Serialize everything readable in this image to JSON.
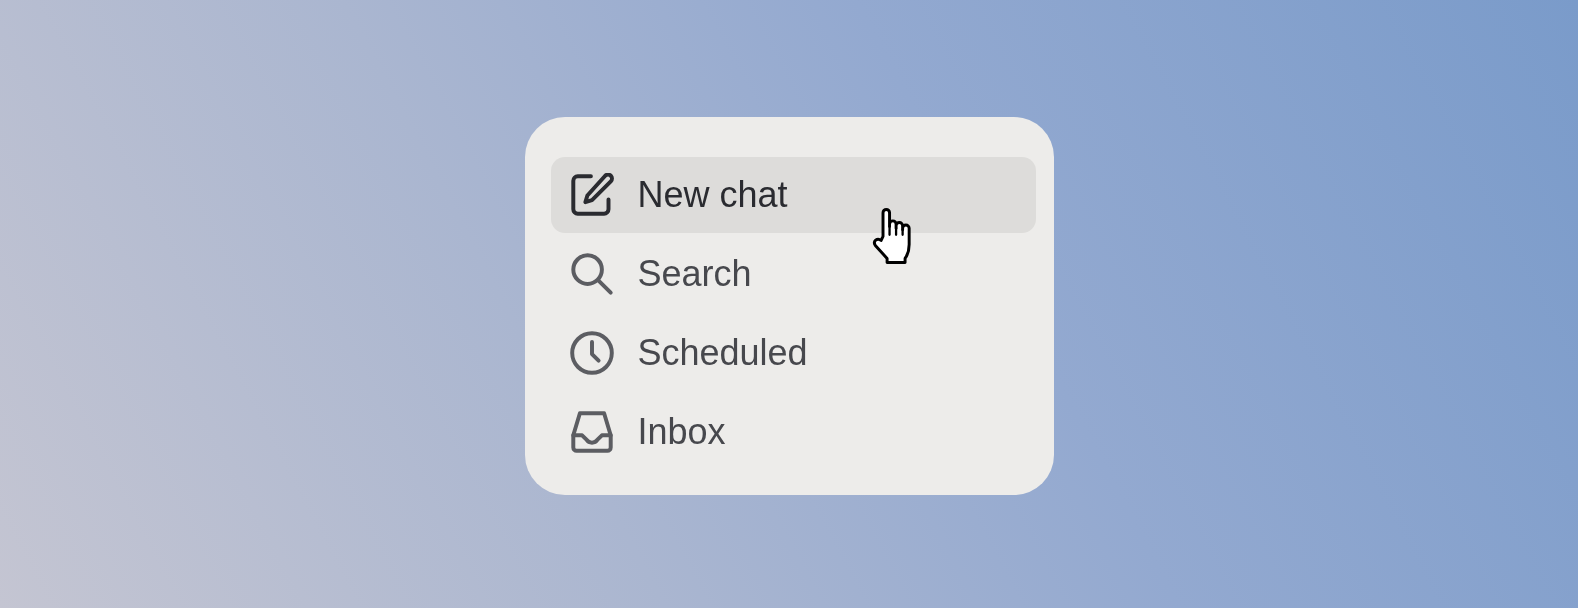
{
  "menu": {
    "items": [
      {
        "label": "New chat",
        "selected": true
      },
      {
        "label": "Search",
        "selected": false
      },
      {
        "label": "Scheduled",
        "selected": false
      },
      {
        "label": "Inbox",
        "selected": false
      }
    ]
  }
}
